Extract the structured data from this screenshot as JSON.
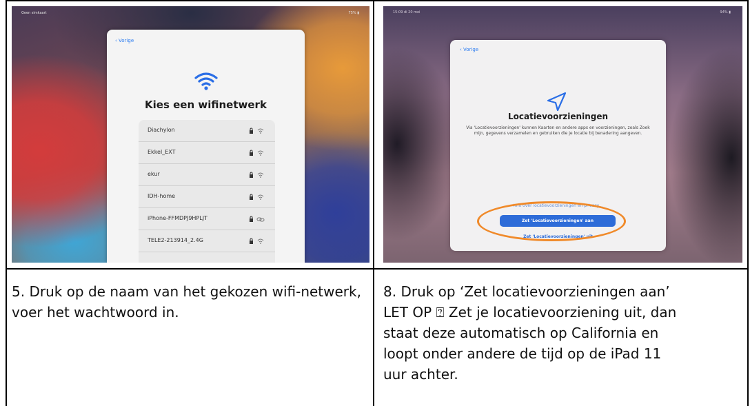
{
  "photo_left": {
    "status_left": "Geen simkaart",
    "status_right": "75% ▮",
    "back_label": "‹ Vorige",
    "title": "Kies een wifinetwerk",
    "networks": [
      {
        "name": "Diachylon",
        "icon": "wifi-icon"
      },
      {
        "name": "Ekkel_EXT",
        "icon": "wifi-icon"
      },
      {
        "name": "ekur",
        "icon": "wifi-icon"
      },
      {
        "name": "IDH-home",
        "icon": "wifi-icon"
      },
      {
        "name": "iPhone-FFMDPJ9HPLJT",
        "icon": "link-icon"
      },
      {
        "name": "TELE2-213914_2.4G",
        "icon": "wifi-icon"
      }
    ]
  },
  "photo_right": {
    "status_left": "15:09  di 20 mei",
    "status_right": "94% ▮",
    "back_label": "‹ Vorige",
    "title": "Locatievoorzieningen",
    "description": "Via 'Locatievoorzieningen' kunnen Kaarten en andere apps en voorzieningen, zoals Zoek mijn, gegevens verzamelen en gebruiken die je locatie bij benadering aangeven.",
    "info_link": "Info over locatievoorzieningen en privacy...",
    "button_label": "Zet 'Locatievoorzieningen' aan",
    "secondary_label": "Zet 'Locatievoorzieningen' uit",
    "highlight_color": "#f08a2a"
  },
  "captions": {
    "left": "5. Druk op de naam van het gekozen wifi-netwerk, voer het wachtwoord in.",
    "right_lines": [
      "8. Druk op ‘Zet locatievoorzieningen aan’",
      "LET OP ⍰ Zet je locatievoorziening uit, dan",
      "staat deze automatisch op California en",
      "loopt onder andere de tijd op de iPad 11",
      "uur achter."
    ]
  }
}
